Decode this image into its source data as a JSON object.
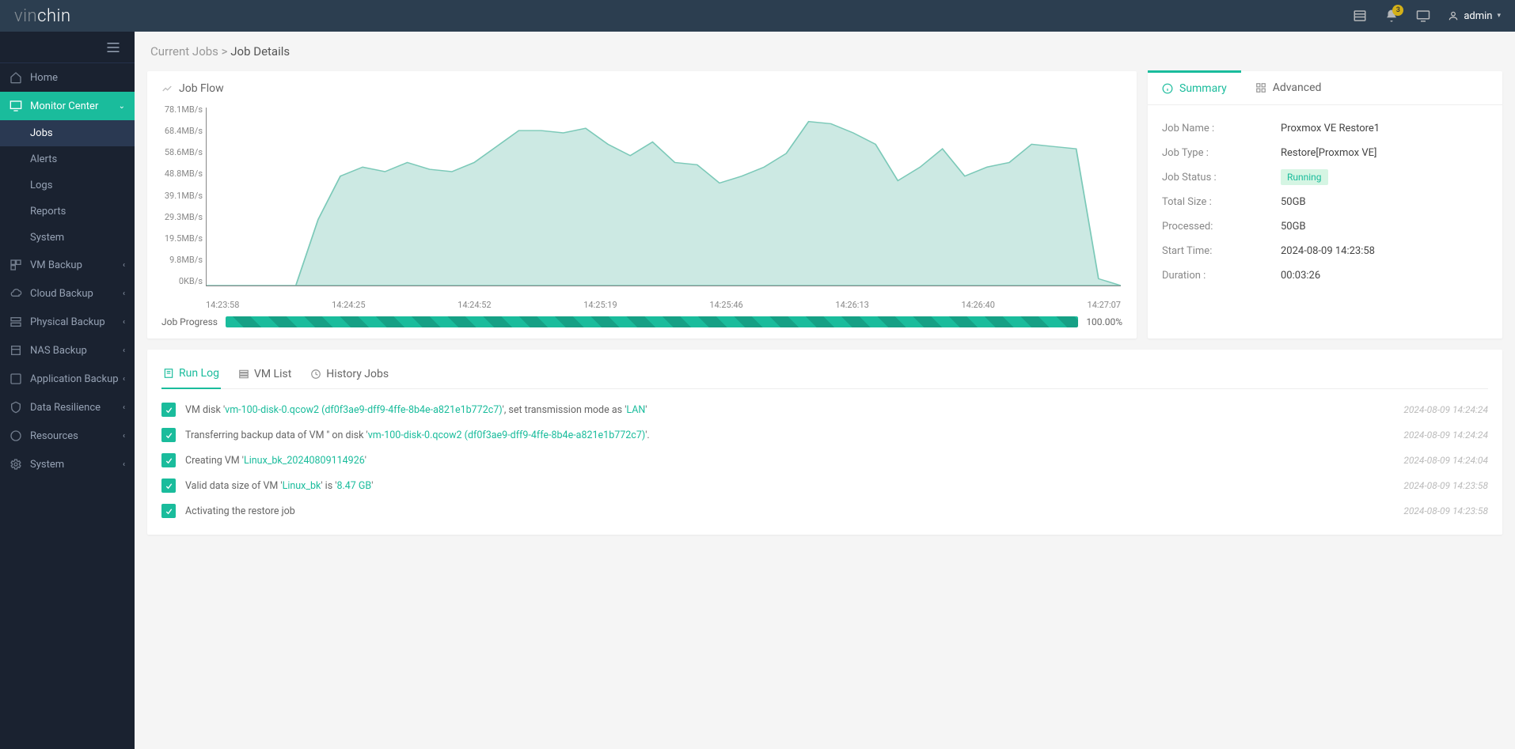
{
  "header": {
    "brand_pre": "vin",
    "brand_post": "chin",
    "bell_badge": "3",
    "user": "admin"
  },
  "sidebar": {
    "home": "Home",
    "monitor_center": "Monitor Center",
    "jobs": "Jobs",
    "alerts": "Alerts",
    "logs": "Logs",
    "reports": "Reports",
    "system_sub": "System",
    "vm_backup": "VM Backup",
    "cloud_backup": "Cloud Backup",
    "physical_backup": "Physical Backup",
    "nas_backup": "NAS Backup",
    "application_backup": "Application Backup",
    "data_resilience": "Data Resilience",
    "resources": "Resources",
    "system": "System"
  },
  "breadcrumb": {
    "parent": "Current Jobs",
    "sep": ">",
    "current": "Job Details"
  },
  "job_flow": {
    "title": "Job Flow",
    "progress_label": "Job Progress",
    "progress_value": "100.00%"
  },
  "chart_data": {
    "type": "area",
    "title": "Job Flow",
    "xlabel": "",
    "ylabel": "",
    "y_unit": "MB/s",
    "ylim": [
      0,
      78.1
    ],
    "y_ticks": [
      "78.1MB/s",
      "68.4MB/s",
      "58.6MB/s",
      "48.8MB/s",
      "39.1MB/s",
      "29.3MB/s",
      "19.5MB/s",
      "9.8MB/s",
      "0KB/s"
    ],
    "x_ticks": [
      "14:23:58",
      "14:24:25",
      "14:24:52",
      "14:25:19",
      "14:25:46",
      "14:26:13",
      "14:26:40",
      "14:27:07"
    ],
    "series": [
      {
        "name": "Throughput",
        "x": [
          "14:23:58",
          "14:24:07",
          "14:24:16",
          "14:24:25",
          "14:24:34",
          "14:24:38",
          "14:24:43",
          "14:24:52",
          "14:24:56",
          "14:25:01",
          "14:25:06",
          "14:25:10",
          "14:25:15",
          "14:25:19",
          "14:25:24",
          "14:25:28",
          "14:25:33",
          "14:25:37",
          "14:25:42",
          "14:25:46",
          "14:25:51",
          "14:25:55",
          "14:26:00",
          "14:26:04",
          "14:26:09",
          "14:26:13",
          "14:26:18",
          "14:26:22",
          "14:26:27",
          "14:26:31",
          "14:26:36",
          "14:26:40",
          "14:26:45",
          "14:26:49",
          "14:26:54",
          "14:26:58",
          "14:27:03",
          "14:27:07",
          "14:27:12",
          "14:27:16",
          "14:27:21",
          "14:27:25"
        ],
        "values": [
          0,
          0,
          0,
          0,
          0,
          29,
          48,
          52,
          50,
          54,
          51,
          50,
          54,
          61,
          68,
          68,
          67,
          69,
          62,
          57,
          63,
          54,
          53,
          45,
          48,
          52,
          58,
          72,
          71,
          67,
          62,
          46,
          52,
          60,
          48,
          52,
          54,
          62,
          61,
          60,
          3,
          0
        ]
      }
    ]
  },
  "summary": {
    "tabs": {
      "summary": "Summary",
      "advanced": "Advanced"
    },
    "rows": {
      "job_name": {
        "label": "Job Name :",
        "value": "Proxmox VE Restore1"
      },
      "job_type": {
        "label": "Job Type :",
        "value": "Restore[Proxmox VE]"
      },
      "job_status": {
        "label": "Job Status :",
        "value": "Running"
      },
      "total_size": {
        "label": "Total Size :",
        "value": "50GB"
      },
      "processed": {
        "label": "Processed:",
        "value": "50GB"
      },
      "start_time": {
        "label": "Start Time:",
        "value": "2024-08-09 14:23:58"
      },
      "duration": {
        "label": "Duration :",
        "value": "00:03:26"
      }
    }
  },
  "log_tabs": {
    "run_log": "Run Log",
    "vm_list": "VM List",
    "history": "History Jobs"
  },
  "run_log": [
    {
      "pre": "VM disk '",
      "hl1": "vm-100-disk-0.qcow2 (df0f3ae9-dff9-4ffe-8b4e-a821e1b772c7)",
      "mid": "', set transmission mode as '",
      "hl2": "LAN",
      "post": "'",
      "ts": "2024-08-09 14:24:24"
    },
    {
      "pre": "Transferring backup data of VM '' on disk '",
      "hl1": "vm-100-disk-0.qcow2 (df0f3ae9-dff9-4ffe-8b4e-a821e1b772c7)",
      "mid": "",
      "hl2": "",
      "post": "'.",
      "ts": "2024-08-09 14:24:24"
    },
    {
      "pre": "Creating VM '",
      "hl1": "Linux_bk_20240809114926",
      "mid": "",
      "hl2": "",
      "post": "'",
      "ts": "2024-08-09 14:24:04"
    },
    {
      "pre": "Valid data size of VM '",
      "hl1": "Linux_bk",
      "mid": "' is '",
      "hl2": "8.47 GB",
      "post": "'",
      "ts": "2024-08-09 14:23:58"
    },
    {
      "pre": "Activating the restore job",
      "hl1": "",
      "mid": "",
      "hl2": "",
      "post": "",
      "ts": "2024-08-09 14:23:58"
    }
  ]
}
